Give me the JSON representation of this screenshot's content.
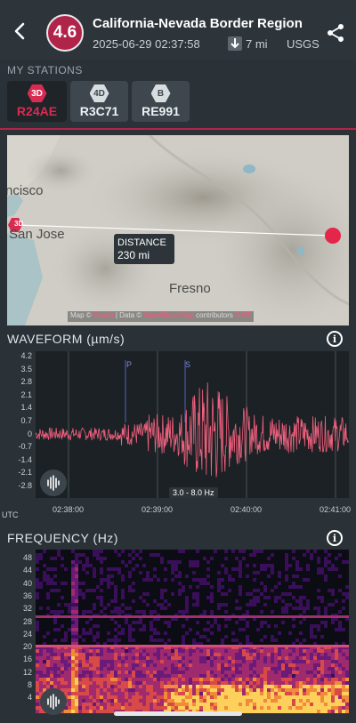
{
  "header": {
    "magnitude": "4.6",
    "title": "California-Nevada Border Region",
    "timestamp": "2025-06-29 02:37:58",
    "depth": "7 mi",
    "source": "USGS",
    "icons": {
      "back": "back-arrow-icon",
      "depth": "down-arrow-icon",
      "share": "share-icon"
    }
  },
  "stations": {
    "label": "MY STATIONS",
    "items": [
      {
        "badge": "3D",
        "code": "R24AE",
        "active": true,
        "color": "#d92b52"
      },
      {
        "badge": "4D",
        "code": "R3C71",
        "active": false,
        "color": "#d8dde0"
      },
      {
        "badge": "B",
        "code": "RE991",
        "active": false,
        "color": "#d8dde0"
      }
    ]
  },
  "map": {
    "labels": {
      "city1": "ncisco",
      "city2": "San Jose",
      "city3": "Fresno"
    },
    "station_marker": "3D",
    "distance_label": "DISTANCE",
    "distance_value": "230 mi",
    "attribution": {
      "prefix": "Map ©",
      "provider": "Stadia",
      "middle": "| Data ©",
      "osm": "OpenStreetMap",
      "suffix": "contributors",
      "extra": "OMT"
    }
  },
  "waveform": {
    "title": "WAVEFORM (µm/s)",
    "y_ticks": [
      "4.2",
      "3.5",
      "2.8",
      "2.1",
      "1.4",
      "0.7",
      "0",
      "-0.7",
      "-1.4",
      "-2.1",
      "-2.8"
    ],
    "x_ticks": [
      "02:38:00",
      "02:39:00",
      "02:40:00",
      "02:41:00"
    ],
    "tz_label": "UTC",
    "filter_label": "3.0 - 8.0 Hz",
    "markers": [
      "P",
      "S"
    ],
    "color": "#f0617e"
  },
  "frequency": {
    "title": "FREQUENCY (Hz)",
    "y_ticks": [
      "48",
      "44",
      "40",
      "36",
      "32",
      "28",
      "24",
      "20",
      "16",
      "12",
      "8",
      "4"
    ]
  }
}
